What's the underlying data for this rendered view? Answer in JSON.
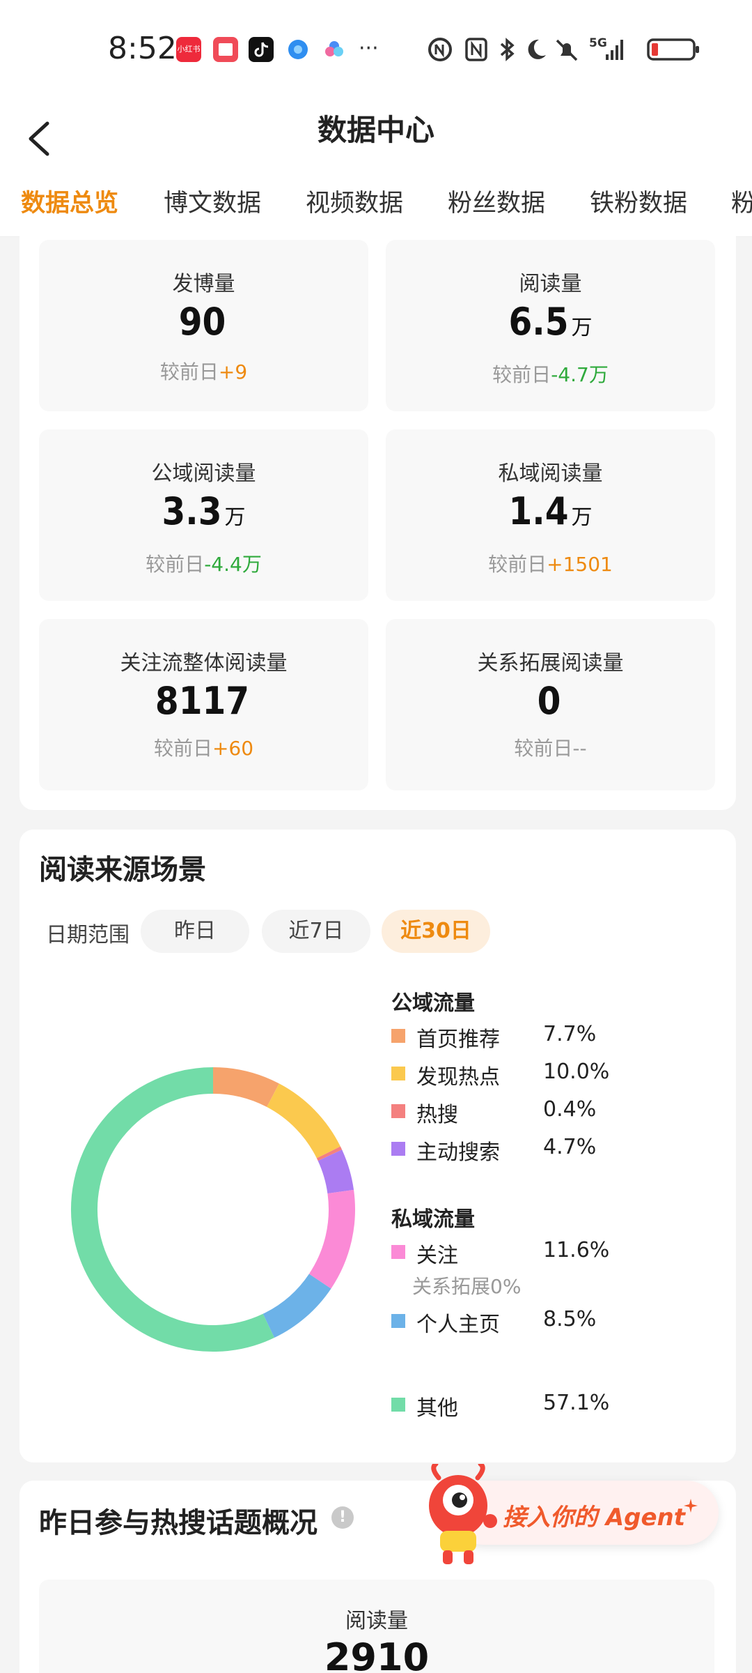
{
  "status_bar": {
    "time": "8:52",
    "app_icons": [
      "xiaohongshu-icon",
      "reader-icon",
      "tiktok-icon",
      "browser-icon",
      "cloud-app-icon"
    ],
    "more": "···",
    "system_icons": [
      "nfc-icon",
      "nfc-n-icon",
      "bluetooth-icon",
      "moon-icon",
      "mute-icon",
      "signal-5g-icon",
      "battery-low-icon"
    ],
    "network": "5G"
  },
  "header": {
    "title": "数据中心",
    "back_icon": "chevron-left-icon"
  },
  "tabs": [
    {
      "label": "数据总览",
      "active": true
    },
    {
      "label": "博文数据",
      "active": false
    },
    {
      "label": "视频数据",
      "active": false
    },
    {
      "label": "粉丝数据",
      "active": false
    },
    {
      "label": "铁粉数据",
      "active": false
    },
    {
      "label": "粉",
      "active": false
    }
  ],
  "metrics": [
    {
      "label": "发博量",
      "value": "90",
      "unit": "",
      "compare_prefix": "较前日",
      "delta": "+9",
      "trend": "up"
    },
    {
      "label": "阅读量",
      "value": "6.5",
      "unit": "万",
      "compare_prefix": "较前日",
      "delta": "-4.7万",
      "trend": "down"
    },
    {
      "label": "公域阅读量",
      "value": "3.3",
      "unit": "万",
      "compare_prefix": "较前日",
      "delta": "-4.4万",
      "trend": "down"
    },
    {
      "label": "私域阅读量",
      "value": "1.4",
      "unit": "万",
      "compare_prefix": "较前日",
      "delta": "+1501",
      "trend": "up"
    },
    {
      "label": "关注流整体阅读量",
      "value": "8117",
      "unit": "",
      "compare_prefix": "较前日",
      "delta": "+60",
      "trend": "up"
    },
    {
      "label": "关系拓展阅读量",
      "value": "0",
      "unit": "",
      "compare_prefix": "较前日",
      "delta": "--",
      "trend": "none"
    }
  ],
  "reading_sources": {
    "title": "阅读来源场景",
    "date_range_label": "日期范围",
    "chips": [
      {
        "label": "昨日",
        "selected": false
      },
      {
        "label": "近7日",
        "selected": false
      },
      {
        "label": "近30日",
        "selected": true
      }
    ],
    "public_group": "公域流量",
    "private_group": "私域流量",
    "legend": [
      {
        "name": "首页推荐",
        "pct": "7.7%",
        "color": "#f6a36c"
      },
      {
        "name": "发现热点",
        "pct": "10.0%",
        "color": "#fbc94e"
      },
      {
        "name": "热搜",
        "pct": "0.4%",
        "color": "#f4807f"
      },
      {
        "name": "主动搜索",
        "pct": "4.7%",
        "color": "#ab7cf2"
      },
      {
        "name": "关注",
        "pct": "11.6%",
        "color": "#fb8ad6"
      },
      {
        "name": "个人主页",
        "pct": "8.5%",
        "color": "#6cb2e8"
      },
      {
        "name": "其他",
        "pct": "57.1%",
        "color": "#72dca8"
      }
    ],
    "relation_note": "关系拓展0%"
  },
  "chart_data": {
    "type": "pie",
    "variant": "donut",
    "categories": [
      "首页推荐",
      "发现热点",
      "热搜",
      "主动搜索",
      "关注",
      "个人主页",
      "其他"
    ],
    "values": [
      7.7,
      10.0,
      0.4,
      4.7,
      11.6,
      8.5,
      57.1
    ],
    "colors": [
      "#f6a36c",
      "#fbc94e",
      "#f4807f",
      "#ab7cf2",
      "#fb8ad6",
      "#6cb2e8",
      "#72dca8"
    ],
    "title": "",
    "legend_position": "right"
  },
  "hot_search": {
    "title": "昨日参与热搜话题概况",
    "info_icon": "info-icon",
    "metric_label": "阅读量",
    "metric_value": "2910"
  },
  "agent_banner": {
    "text": "接入你的 Agent",
    "mascot_icon": "mascot-icon",
    "sparkle_icon": "sparkle-icon"
  }
}
